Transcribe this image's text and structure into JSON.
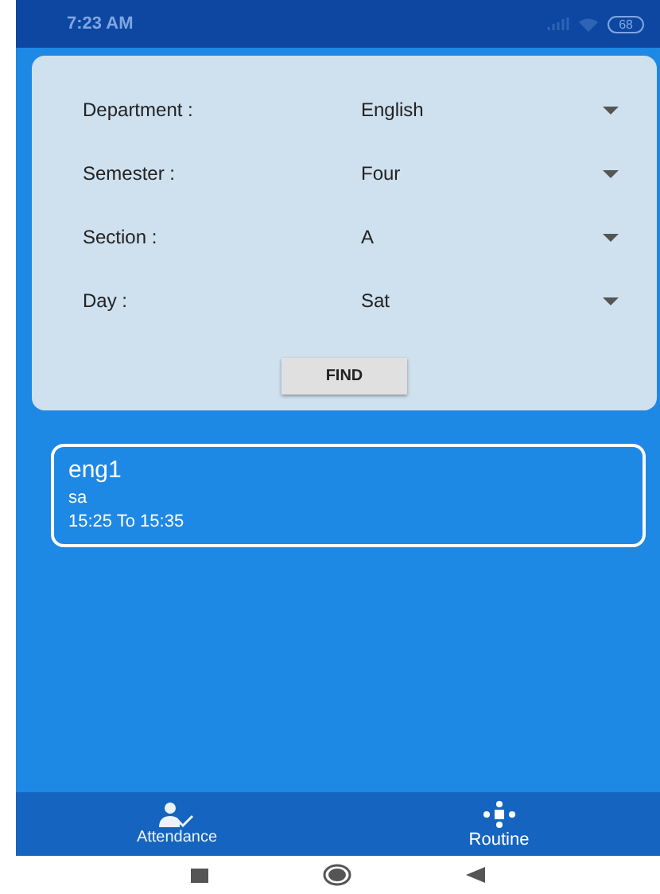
{
  "status_bar": {
    "time": "7:23 AM",
    "battery": "68"
  },
  "form": {
    "fields": [
      {
        "label": "Department :",
        "value": "English"
      },
      {
        "label": "Semester :",
        "value": "Four"
      },
      {
        "label": "Section :",
        "value": "A"
      },
      {
        "label": "Day :",
        "value": "Sat"
      }
    ],
    "button": "FIND"
  },
  "results": [
    {
      "title": "eng1",
      "subtitle": "sa",
      "time": "15:25 To 15:35"
    }
  ],
  "bottom_nav": [
    {
      "label": "Attendance",
      "kind": "attendance",
      "selected": false
    },
    {
      "label": "Routine",
      "kind": "routine",
      "selected": true
    }
  ]
}
